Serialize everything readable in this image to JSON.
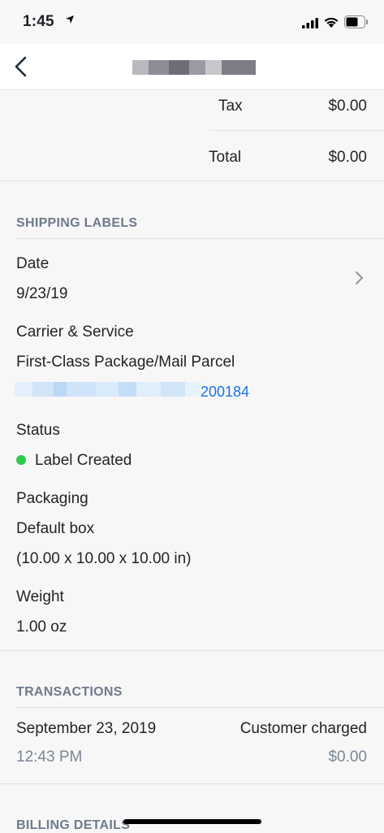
{
  "status_bar": {
    "time": "1:45"
  },
  "summary": {
    "tax_label": "Tax",
    "tax_value": "$0.00",
    "total_label": "Total",
    "total_value": "$0.00"
  },
  "shipping_labels": {
    "header": "SHIPPING LABELS",
    "date_label": "Date",
    "date_value": "9/23/19",
    "carrier_label": "Carrier & Service",
    "carrier_value": "First-Class Package/Mail Parcel",
    "tracking_suffix": "200184",
    "status_label": "Status",
    "status_value": "Label Created",
    "status_color": "#2fc84f",
    "packaging_label": "Packaging",
    "packaging_value": "Default box",
    "packaging_dims": "(10.00 x 10.00 x 10.00 in)",
    "weight_label": "Weight",
    "weight_value": "1.00 oz"
  },
  "transactions": {
    "header": "TRANSACTIONS",
    "date": "September 23, 2019",
    "time": "12:43 PM",
    "type": "Customer charged",
    "amount": "$0.00"
  },
  "billing": {
    "header": "BILLING DETAILS"
  },
  "colors": {
    "accent_link": "#1a73e8",
    "section_header": "#6f7b8c"
  },
  "icons": {
    "back": "chevron-left-icon",
    "row_chevron": "chevron-right-icon",
    "location": "location-arrow-icon",
    "cellular": "cellular-signal-icon",
    "wifi": "wifi-icon",
    "battery": "battery-icon"
  }
}
